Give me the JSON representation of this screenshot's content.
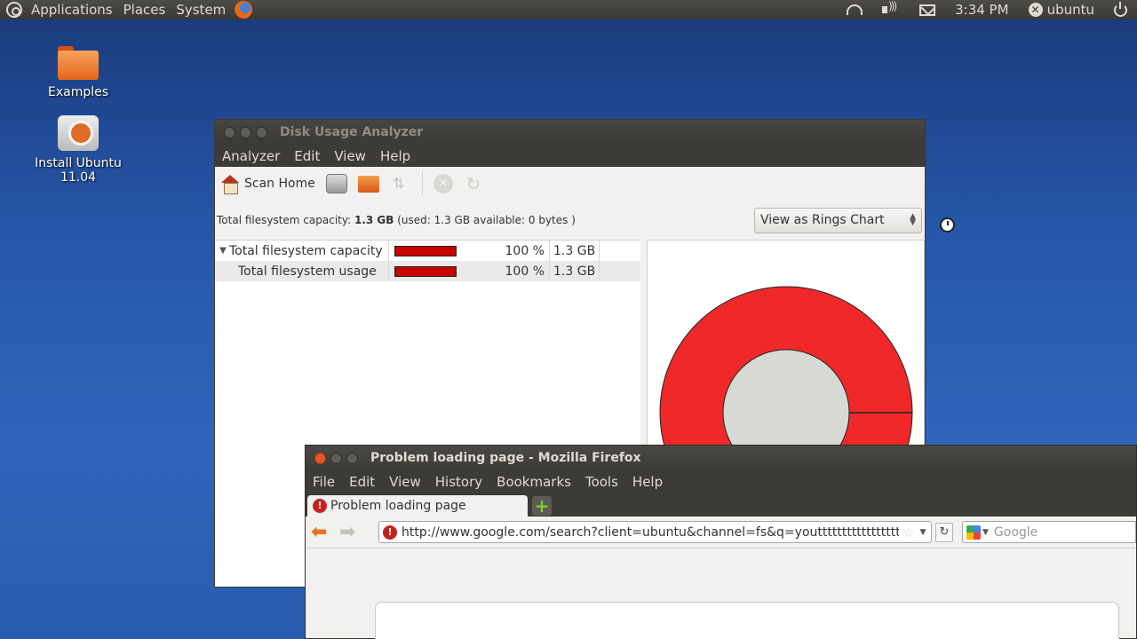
{
  "top_panel": {
    "menus": [
      "Applications",
      "Places",
      "System"
    ],
    "clock": "3:34 PM",
    "user": "ubuntu"
  },
  "desktop": {
    "icons": [
      {
        "label": "Examples",
        "icon": "folder-icon"
      },
      {
        "label": "Install Ubuntu 11.04",
        "icon": "installer-icon"
      }
    ]
  },
  "disk_usage_analyzer": {
    "title": "Disk Usage Analyzer",
    "menu": [
      "Analyzer",
      "Edit",
      "View",
      "Help"
    ],
    "toolbar": {
      "scan_home_label": "Scan Home"
    },
    "capacity_caption": {
      "prefix": "Total filesystem capacity: ",
      "value": "1.3 GB",
      "suffix": " (used: 1.3 GB available: 0 bytes )"
    },
    "view_select": "View as Rings Chart",
    "rows": [
      {
        "name": "Total filesystem capacity",
        "percent": "100 %",
        "size": "1.3 GB",
        "fraction": 1.0
      },
      {
        "name": "Total filesystem usage",
        "percent": "100 %",
        "size": "1.3 GB",
        "fraction": 1.0
      }
    ],
    "colors": {
      "bar": "#c70000",
      "ring": "#ef2929",
      "center": "#d7d9d4"
    }
  },
  "firefox": {
    "title": "Problem loading page - Mozilla Firefox",
    "menu": [
      "File",
      "Edit",
      "View",
      "History",
      "Bookmarks",
      "Tools",
      "Help"
    ],
    "tab_label": "Problem loading page",
    "url": "http://www.google.com/search?client=ubuntu&channel=fs&q=youtttttttttttttttttttt",
    "search_placeholder": "Google"
  }
}
